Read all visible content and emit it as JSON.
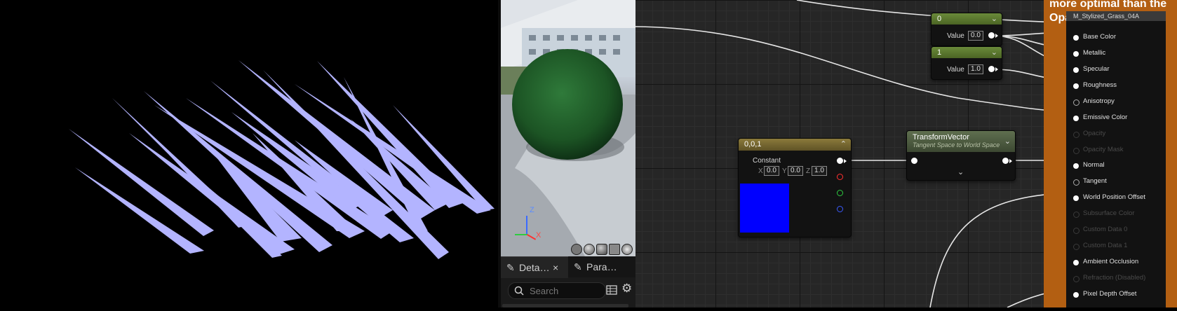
{
  "texture_preview": {
    "color": "#b3b4ff"
  },
  "viewport": {
    "axis": {
      "z": "Z",
      "x": "X"
    }
  },
  "details_panel": {
    "tabs": [
      {
        "label": "Deta…",
        "icon": "pencil-icon"
      },
      {
        "label": "Para…",
        "icon": "pencil-icon"
      }
    ],
    "close_glyph": "×",
    "search": {
      "placeholder": "Search"
    }
  },
  "graph": {
    "comment_text": "more optimal than the\nOpaque material",
    "node_scalar_0": {
      "title": "0",
      "value_label": "Value",
      "value": "0.0"
    },
    "node_scalar_1": {
      "title": "1",
      "value_label": "Value",
      "value": "1.0"
    },
    "node_constant": {
      "title": "0,0,1",
      "subtitle": "Constant",
      "x_label": "X",
      "x": "0.0",
      "y_label": "Y",
      "y": "0.0",
      "z_label": "Z",
      "z": "1.0",
      "swatch_color": "#0000ff"
    },
    "node_transform": {
      "title": "TransformVector",
      "subtitle": "Tangent Space to World Space"
    },
    "result_node": {
      "title": "M_Stylized_Grass_04A",
      "inputs": [
        {
          "label": "Base Color",
          "enabled": true
        },
        {
          "label": "Metallic",
          "enabled": true
        },
        {
          "label": "Specular",
          "enabled": true
        },
        {
          "label": "Roughness",
          "enabled": true
        },
        {
          "label": "Anisotropy",
          "enabled": true
        },
        {
          "label": "Emissive Color",
          "enabled": true
        },
        {
          "label": "Opacity",
          "enabled": false
        },
        {
          "label": "Opacity Mask",
          "enabled": false
        },
        {
          "label": "Normal",
          "enabled": true
        },
        {
          "label": "Tangent",
          "enabled": true
        },
        {
          "label": "World Position Offset",
          "enabled": true
        },
        {
          "label": "Subsurface Color",
          "enabled": false
        },
        {
          "label": "Custom Data 0",
          "enabled": false
        },
        {
          "label": "Custom Data 1",
          "enabled": false
        },
        {
          "label": "Ambient Occlusion",
          "enabled": true
        },
        {
          "label": "Refraction (Disabled)",
          "enabled": false
        },
        {
          "label": "Pixel Depth Offset",
          "enabled": true
        }
      ]
    }
  }
}
